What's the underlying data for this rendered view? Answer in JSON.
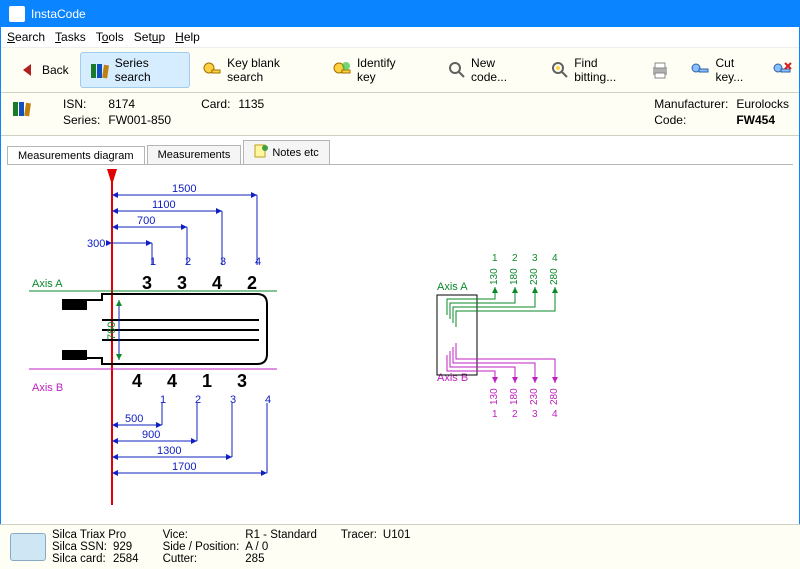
{
  "window": {
    "title": "InstaCode"
  },
  "menu": {
    "search": "Search",
    "tasks": "Tasks",
    "tools": "Tools",
    "setup": "Setup",
    "help": "Help"
  },
  "toolbar": {
    "back": "Back",
    "series_search": "Series search",
    "key_blank_search": "Key blank search",
    "identify_key": "Identify key",
    "new_code": "New code...",
    "find_bitting": "Find bitting...",
    "cut_key": "Cut key..."
  },
  "info": {
    "isn_label": "ISN:",
    "isn": "8174",
    "card_label": "Card:",
    "card": "1135",
    "series_label": "Series:",
    "series": "FW001-850",
    "manufacturer_label": "Manufacturer:",
    "manufacturer": "Eurolocks",
    "code_label": "Code:",
    "code": "FW454"
  },
  "tabs": {
    "measurements_diagram": "Measurements diagram",
    "measurements": "Measurements",
    "notes": "Notes etc"
  },
  "diagram": {
    "axisA": "Axis A",
    "axisB": "Axis B",
    "top_offsets": [
      "300",
      "700",
      "1100",
      "1500"
    ],
    "top_positions": [
      "1",
      "2",
      "3",
      "4"
    ],
    "top_bitting": [
      "3",
      "3",
      "4",
      "2"
    ],
    "side_value": "760",
    "bottom_bitting": [
      "4",
      "4",
      "1",
      "3"
    ],
    "bottom_positions": [
      "1",
      "2",
      "3",
      "4"
    ],
    "bottom_offsets": [
      "500",
      "900",
      "1300",
      "1700"
    ],
    "right": {
      "top_positions": [
        "1",
        "2",
        "3",
        "4"
      ],
      "top_values": [
        "130",
        "180",
        "230",
        "280"
      ],
      "bottom_values": [
        "130",
        "180",
        "230",
        "280"
      ],
      "bottom_positions": [
        "1",
        "2",
        "3",
        "4"
      ]
    }
  },
  "footer": {
    "machine": "Silca Triax Pro",
    "ssn_label": "Silca SSN:",
    "ssn": "929",
    "card_label": "Silca card:",
    "card": "2584",
    "vice_label": "Vice:",
    "vice": "R1 - Standard",
    "side_label": "Side / Position:",
    "side": "A / 0",
    "cutter_label": "Cutter:",
    "cutter": "285",
    "tracer_label": "Tracer:",
    "tracer": "U101"
  }
}
